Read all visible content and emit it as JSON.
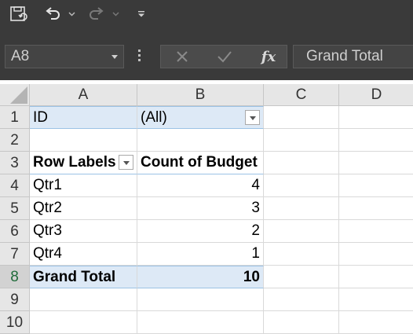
{
  "quick_access": {
    "icons": [
      "save-icon",
      "undo-icon",
      "undo-dropdown-icon",
      "redo-icon",
      "redo-dropdown-icon",
      "customize-toolbar-icon"
    ]
  },
  "formula_bar": {
    "name_box": "A8",
    "fx_label": "fx",
    "formula_value": "Grand Total",
    "icons": [
      "name-box-dropdown-icon",
      "more-options-icon",
      "cancel-icon",
      "enter-icon",
      "insert-function-icon"
    ]
  },
  "sheet": {
    "columns": [
      "A",
      "B",
      "C",
      "D"
    ],
    "rows": [
      "1",
      "2",
      "3",
      "4",
      "5",
      "6",
      "7",
      "8",
      "9",
      "10"
    ],
    "active_row": "8",
    "filter": {
      "field": "ID",
      "value": "(All)"
    },
    "header": {
      "row_labels": "Row Labels",
      "value_field": "Count of Budget"
    },
    "data_rows": [
      {
        "label": "Qtr1",
        "value": "4"
      },
      {
        "label": "Qtr2",
        "value": "3"
      },
      {
        "label": "Qtr3",
        "value": "2"
      },
      {
        "label": "Qtr4",
        "value": "1"
      }
    ],
    "grand_total": {
      "label": "Grand Total",
      "value": "10"
    }
  },
  "colors": {
    "chrome_bg": "#3a3a3a",
    "pivot_tint": "#dde9f6",
    "pivot_line": "#9cc2e5",
    "header_bg": "#e6e6e6"
  }
}
